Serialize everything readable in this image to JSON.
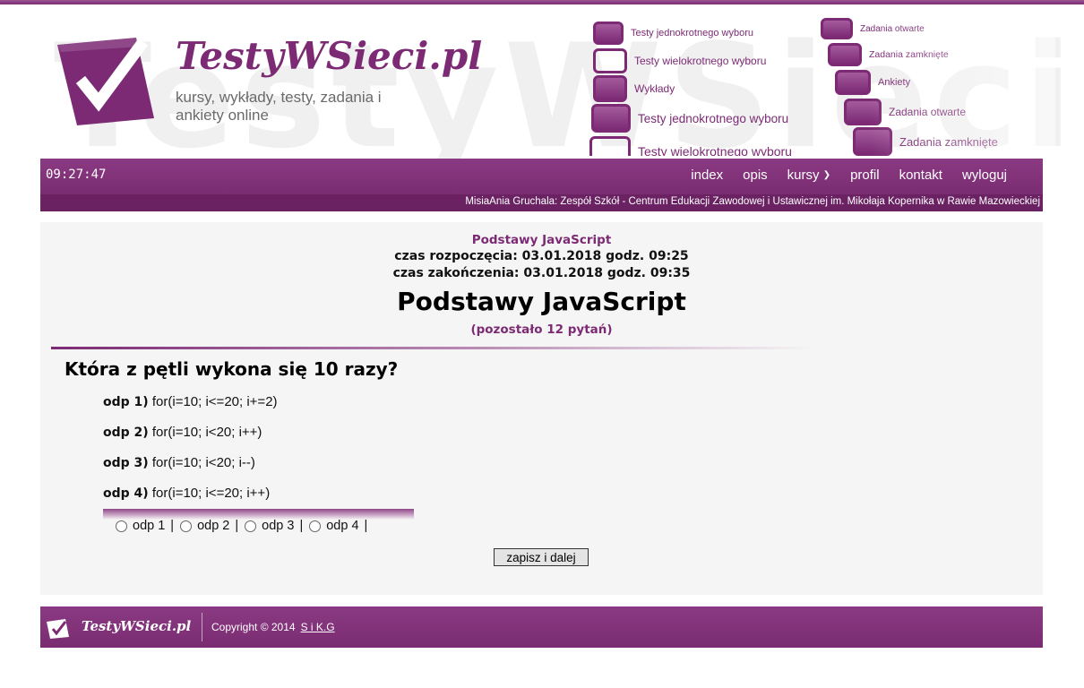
{
  "header": {
    "watermark": "TestyWSieci",
    "brand": "TestyWSieci.pl",
    "tagline": "kursy, wykłady, testy, zadania i ankiety online",
    "collage": [
      "Testy jednokrotnego wyboru",
      "Testy wielokrotnego wyboru",
      "Wykłady",
      "Testy jednokrotnego wyboru",
      "Testy wielokrotnego wyboru",
      "Zadania otwarte",
      "Zadania zamknięte",
      "Ankiety",
      "Zadania otwarte",
      "Zadania zamknięte"
    ]
  },
  "nav": {
    "clock": "09:27:47",
    "items": [
      "index",
      "opis",
      "kursy",
      "profil",
      "kontakt",
      "wyloguj"
    ],
    "user_line": "MisiaAnia Gruchala: Zespół Szkół - Centrum Edukacji Zawodowej i Ustawicznej im. Mikołaja Kopernika w Rawie Mazowieckiej"
  },
  "test": {
    "subject": "Podstawy JavaScript",
    "start": "czas rozpoczęcia: 03.01.2018 godz. 09:25",
    "end": "czas zakończenia: 03.01.2018 godz. 09:35",
    "title": "Podstawy JavaScript",
    "remaining": "(pozostało 12 pytań)",
    "question": "Która z pętli wykona się 10 razy?",
    "answers": [
      {
        "label": "odp 1)",
        "text": " for(i=10; i<=20; i+=2)"
      },
      {
        "label": "odp 2)",
        "text": "for(i=10; i<20; i++)"
      },
      {
        "label": "odp 3)",
        "text": "for(i=10; i<20; i--)"
      },
      {
        "label": "odp 4)",
        "text": "for(i=10; i<=20; i++)"
      }
    ],
    "options": [
      "odp 1",
      "odp 2",
      "odp 3",
      "odp 4"
    ],
    "separator": "|",
    "submit": "zapisz i dalej"
  },
  "footer": {
    "brand": "TestyWSieci.pl",
    "copyright": "Copyright © 2014",
    "author": "S i K.G"
  },
  "colors": {
    "brand": "#7c2a74",
    "panel": "#f5f5f5"
  }
}
